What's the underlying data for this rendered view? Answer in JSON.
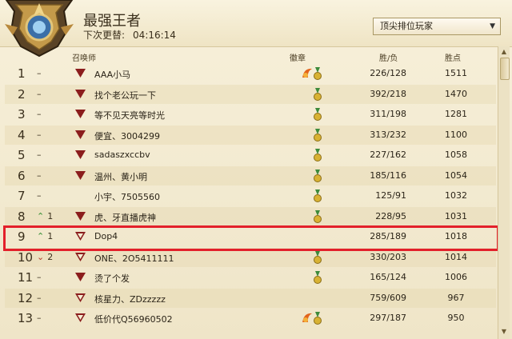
{
  "header": {
    "title": "最强王者",
    "update_label": "下次更替:",
    "update_time": "04:16:14",
    "filter_selected": "顶尖排位玩家"
  },
  "columns": {
    "summoner": "召唤师",
    "badges": "徽章",
    "win_loss": "胜/负",
    "points": "胜点"
  },
  "rows": [
    {
      "rank": "1",
      "change_dir": "none",
      "change": "",
      "name": "AAA小马",
      "badges": [
        "fire",
        "medal"
      ],
      "win_loss": "226/128",
      "points": "1511",
      "icon": "v"
    },
    {
      "rank": "2",
      "change_dir": "none",
      "change": "",
      "name": "找个老公玩一下",
      "badges": [
        "medal"
      ],
      "win_loss": "392/218",
      "points": "1470",
      "icon": "v"
    },
    {
      "rank": "3",
      "change_dir": "none",
      "change": "",
      "name": "等不见天亮等时光",
      "badges": [
        "medal"
      ],
      "win_loss": "311/198",
      "points": "1281",
      "icon": "v"
    },
    {
      "rank": "4",
      "change_dir": "none",
      "change": "",
      "name": "便宜、3004299",
      "badges": [
        "medal"
      ],
      "win_loss": "313/232",
      "points": "1100",
      "icon": "v"
    },
    {
      "rank": "5",
      "change_dir": "none",
      "change": "",
      "name": "sadaszxccbv",
      "badges": [
        "medal"
      ],
      "win_loss": "227/162",
      "points": "1058",
      "icon": "v"
    },
    {
      "rank": "6",
      "change_dir": "none",
      "change": "",
      "name": "温州、黄小明",
      "badges": [
        "medal"
      ],
      "win_loss": "185/116",
      "points": "1054",
      "icon": "v"
    },
    {
      "rank": "7",
      "change_dir": "none",
      "change": "",
      "name": "小宇、7505560",
      "badges": [
        "medal"
      ],
      "win_loss": "125/91",
      "points": "1032",
      "icon": "none"
    },
    {
      "rank": "8",
      "change_dir": "up",
      "change": "1",
      "name": "虎、牙直播虎神",
      "badges": [
        "medal"
      ],
      "win_loss": "228/95",
      "points": "1031",
      "icon": "v"
    },
    {
      "rank": "9",
      "change_dir": "up",
      "change": "1",
      "name": "Dop4",
      "badges": [],
      "win_loss": "285/189",
      "points": "1018",
      "icon": "vo"
    },
    {
      "rank": "10",
      "change_dir": "down",
      "change": "2",
      "name": "ONE、2O5411111",
      "badges": [
        "medal"
      ],
      "win_loss": "330/203",
      "points": "1014",
      "icon": "vo"
    },
    {
      "rank": "11",
      "change_dir": "none",
      "change": "",
      "name": "烫了个发",
      "badges": [
        "medal"
      ],
      "win_loss": "165/124",
      "points": "1006",
      "icon": "v"
    },
    {
      "rank": "12",
      "change_dir": "none",
      "change": "",
      "name": "核星力、ZDzzzzz",
      "badges": [],
      "win_loss": "759/609",
      "points": "967",
      "icon": "vo"
    },
    {
      "rank": "13",
      "change_dir": "none",
      "change": "",
      "name": "低价代Q56960502",
      "badges": [
        "fire",
        "medal"
      ],
      "win_loss": "297/187",
      "points": "950",
      "icon": "vo"
    }
  ],
  "colors": {
    "highlight": "#e3202a",
    "up": "#2e8b2e",
    "down": "#b23b2a",
    "icon": "#8b1d1d"
  }
}
